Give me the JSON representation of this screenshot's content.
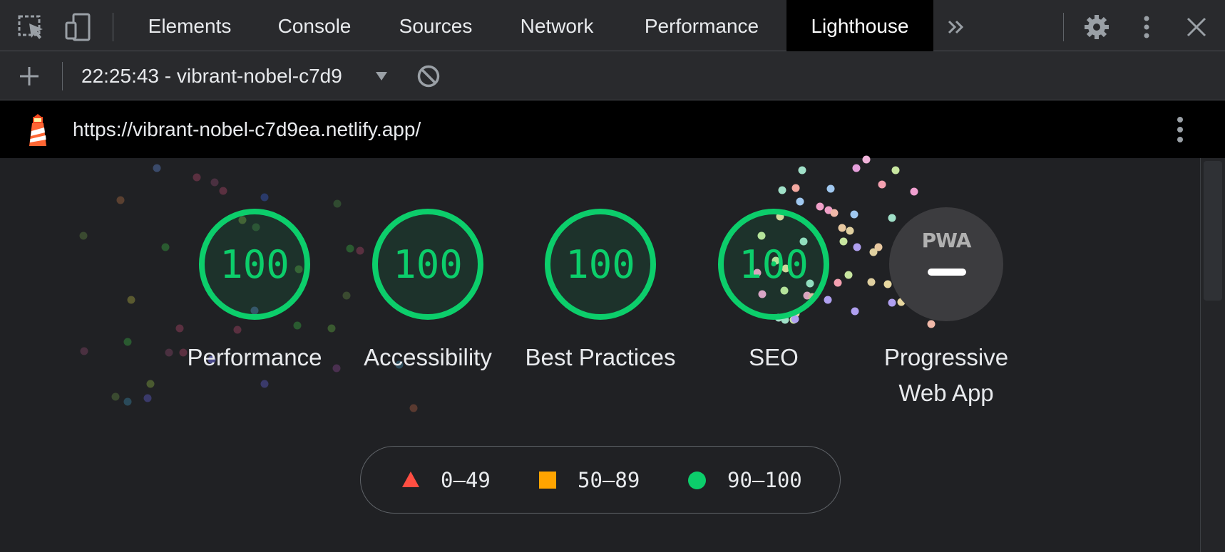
{
  "devtools": {
    "tabs": [
      {
        "label": "Elements"
      },
      {
        "label": "Console"
      },
      {
        "label": "Sources"
      },
      {
        "label": "Network"
      },
      {
        "label": "Performance"
      },
      {
        "label": "Lighthouse"
      }
    ],
    "active_tab": "Lighthouse",
    "toolbar_icons": [
      "inspect-element-icon",
      "device-toolbar-icon",
      "more-tabs-icon",
      "settings-icon",
      "kebab-menu-icon",
      "close-icon"
    ]
  },
  "report_bar": {
    "selected_report": "22:25:43 - vibrant-nobel-c7d9",
    "icons": [
      "add-icon",
      "dropdown-caret-icon",
      "clear-reports-icon"
    ]
  },
  "url_bar": {
    "url": "https://vibrant-nobel-c7d9ea.netlify.app/",
    "icons": [
      "lighthouse-logo-icon",
      "report-menu-icon"
    ]
  },
  "scores": [
    {
      "label": "Performance",
      "value": "100"
    },
    {
      "label": "Accessibility",
      "value": "100"
    },
    {
      "label": "Best Practices",
      "value": "100"
    },
    {
      "label": "SEO",
      "value": "100"
    }
  ],
  "pwa": {
    "label": "Progressive Web App",
    "badge": "PWA"
  },
  "legend": [
    {
      "range": "0–49",
      "shape": "triangle",
      "color": "#ff4e42"
    },
    {
      "range": "50–89",
      "shape": "square",
      "color": "#ffa400"
    },
    {
      "range": "90–100",
      "shape": "circle",
      "color": "#0cce6b"
    }
  ],
  "colors": {
    "pass": "#0cce6b",
    "average": "#ffa400",
    "fail": "#ff4e42",
    "background": "#202124"
  }
}
